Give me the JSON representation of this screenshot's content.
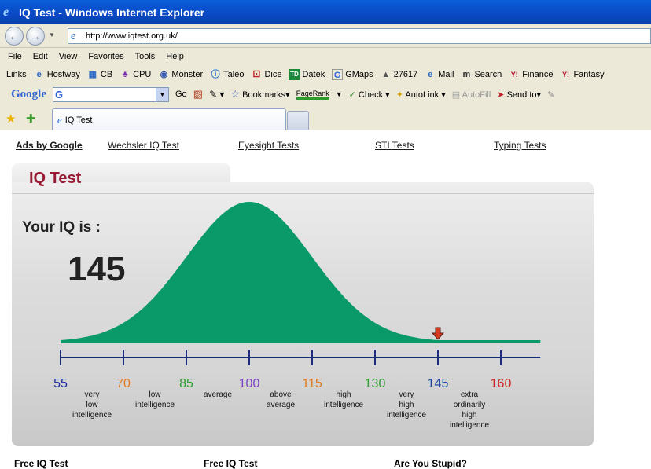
{
  "window": {
    "title": "IQ Test - Windows Internet Explorer"
  },
  "address": {
    "url": "http://www.iqtest.org.uk/"
  },
  "menu": [
    "File",
    "Edit",
    "View",
    "Favorites",
    "Tools",
    "Help"
  ],
  "links_bar": {
    "label": "Links",
    "items": [
      "Hostway",
      "CB",
      "CPU",
      "Monster",
      "Taleo",
      "Dice",
      "Datek",
      "GMaps",
      "27617",
      "Mail",
      "Search",
      "Finance",
      "Fantasy"
    ]
  },
  "google_bar": {
    "logo": "Google",
    "search_glyph": "G",
    "go_label": "Go",
    "bookmarks_label": "Bookmarks",
    "pagerank_label": "PageRank",
    "check_label": "Check",
    "autolink_label": "AutoLink",
    "autofill_label": "AutoFill",
    "sendto_label": "Send to"
  },
  "tab": {
    "title": "IQ Test"
  },
  "page": {
    "ad_links": {
      "ads_by": "Ads by Google",
      "items": [
        "Wechsler IQ Test",
        "Eyesight Tests",
        "STI Tests",
        "Typing Tests"
      ]
    },
    "panel_title": "IQ Test",
    "your_iq_label": "Your IQ is :",
    "iq_value": "145",
    "footer_links": [
      "Free IQ Test",
      "Free IQ Test",
      "Are You Stupid?"
    ]
  },
  "chart_data": {
    "type": "area",
    "x_ticks": [
      55,
      70,
      85,
      100,
      115,
      130,
      145,
      160
    ],
    "tick_labels": [
      "55",
      "70",
      "85",
      "100",
      "115",
      "130",
      "145",
      "160"
    ],
    "tick_colors": [
      "#1c2a9c",
      "#e07a20",
      "#2e9a2e",
      "#7a3fc0",
      "#e07a20",
      "#2e9a2e",
      "#1c4aa0",
      "#cc2222"
    ],
    "categories": [
      [
        "very",
        "low",
        "intelligence"
      ],
      [
        "low",
        "intelligence"
      ],
      [
        "average"
      ],
      [
        "above",
        "average"
      ],
      [
        "high",
        "intelligence"
      ],
      [
        "very",
        "high",
        "intelligence"
      ],
      [
        "extra",
        "ordinarily",
        "high",
        "intelligence"
      ]
    ],
    "curve": {
      "mean": 100,
      "sd": 15,
      "color": "#0a9a6a"
    },
    "marker_value": 145,
    "marker_color": "#d43a20",
    "xlim": [
      55,
      170
    ]
  }
}
